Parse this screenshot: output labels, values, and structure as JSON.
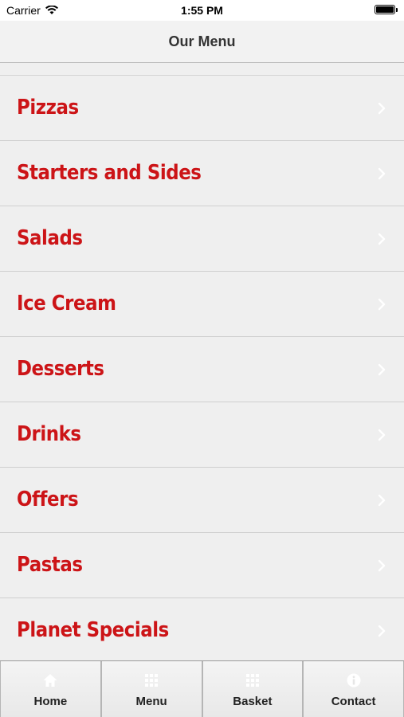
{
  "status_bar": {
    "carrier": "Carrier",
    "time": "1:55 PM",
    "battery_level": 1.0
  },
  "nav": {
    "title": "Our Menu"
  },
  "menu": {
    "items": [
      {
        "label": "Pizzas"
      },
      {
        "label": "Starters and Sides"
      },
      {
        "label": "Salads"
      },
      {
        "label": "Ice Cream"
      },
      {
        "label": "Desserts"
      },
      {
        "label": "Drinks"
      },
      {
        "label": "Offers"
      },
      {
        "label": "Pastas"
      },
      {
        "label": "Planet Specials"
      }
    ]
  },
  "tabs": [
    {
      "label": "Home",
      "icon": "home-icon"
    },
    {
      "label": "Menu",
      "icon": "grid-icon"
    },
    {
      "label": "Basket",
      "icon": "grid-icon"
    },
    {
      "label": "Contact",
      "icon": "info-icon"
    }
  ],
  "colors": {
    "accent": "#cc1417",
    "background": "#efefef",
    "tab_icon": "#ffffff"
  }
}
